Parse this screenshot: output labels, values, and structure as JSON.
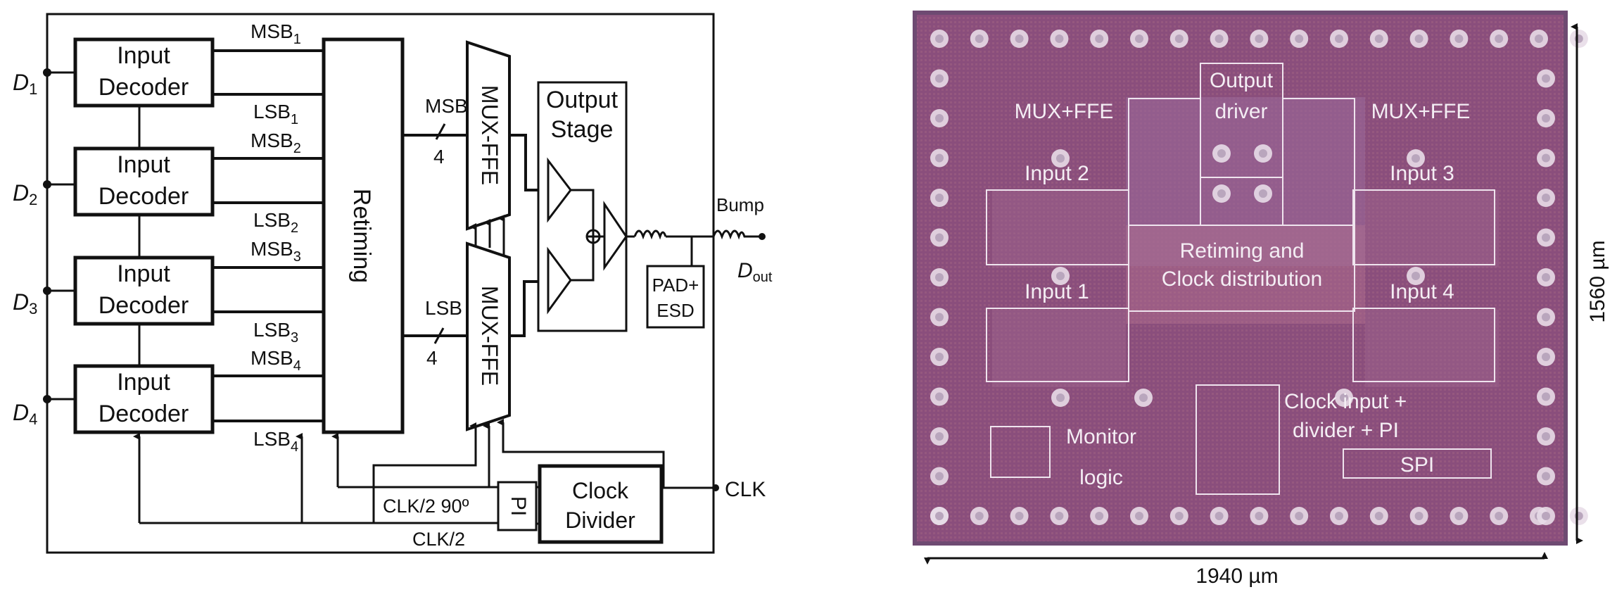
{
  "block_diagram": {
    "inputs": [
      {
        "label": "D",
        "sub": "1"
      },
      {
        "label": "D",
        "sub": "2"
      },
      {
        "label": "D",
        "sub": "3"
      },
      {
        "label": "D",
        "sub": "4"
      }
    ],
    "decoders": [
      {
        "line1": "Input",
        "line2": "Decoder"
      },
      {
        "line1": "Input",
        "line2": "Decoder"
      },
      {
        "line1": "Input",
        "line2": "Decoder"
      },
      {
        "line1": "Input",
        "line2": "Decoder"
      }
    ],
    "bits": [
      {
        "msb": "MSB",
        "lsb": "LSB",
        "sub": "1"
      },
      {
        "msb": "MSB",
        "lsb": "LSB",
        "sub": "2"
      },
      {
        "msb": "MSB",
        "lsb": "LSB",
        "sub": "3"
      },
      {
        "msb": "MSB",
        "lsb": "LSB",
        "sub": "4"
      }
    ],
    "retiming": "Retiming",
    "bus_msb": "MSB",
    "bus_lsb": "LSB",
    "bus_width": "4",
    "mux_top": "MUX-FFE",
    "mux_bottom": "MUX-FFE",
    "output_stage_line1": "Output",
    "output_stage_line2": "Stage",
    "pad_line1": "PAD+",
    "pad_line2": "ESD",
    "bump": "Bump",
    "dout": "D",
    "dout_sub": "out",
    "pi": "PI",
    "clock_divider_line1": "Clock",
    "clock_divider_line2": "Divider",
    "clk": "CLK",
    "clk_half_90": "CLK/2 90º",
    "clk_half": "CLK/2"
  },
  "chip_photo": {
    "labels": {
      "mux_ffe_left": "MUX+FFE",
      "mux_ffe_right": "MUX+FFE",
      "output_driver_line1": "Output",
      "output_driver_line2": "driver",
      "input2": "Input 2",
      "input3": "Input 3",
      "input1": "Input 1",
      "input4": "Input 4",
      "retiming_line1": "Retiming and",
      "retiming_line2": "Clock distribution",
      "clock_line1": "Clock input +",
      "clock_line2": "divider + PI",
      "monitor_line1": "Monitor",
      "monitor_line2": "logic",
      "spi": "SPI"
    },
    "width_label": "1940 µm",
    "height_label": "1560 µm",
    "colors": {
      "die": "#8a4e7c",
      "die_edge": "#6e4a72",
      "pad": "#e8dde8",
      "label": "#f4eef4"
    }
  }
}
